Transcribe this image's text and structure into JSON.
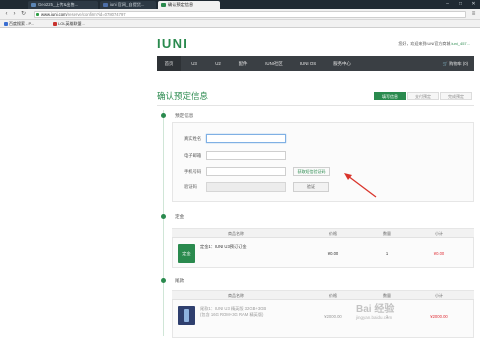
{
  "browser": {
    "tabs": [
      {
        "title": "Geo225_上传&出售...",
        "color": "#5c86b5",
        "active": false
      },
      {
        "title": "iuni 官网_自提货...",
        "color": "#4d6fa8",
        "active": false
      },
      {
        "title": "确认预定信息",
        "color": "#2a8a4e",
        "active": true
      }
    ],
    "window_controls": [
      "–",
      "□",
      "✕"
    ],
    "url_host": "www.iuni.com",
    "url_path": "/reserve/confirm?id=078074797",
    "bookmarks": [
      {
        "label": "百度搜索 - P...",
        "color": "#3a6ed1"
      },
      {
        "label": "LOL英雄联盟...",
        "color": "#c8332e"
      }
    ]
  },
  "site": {
    "logo": "IUNI",
    "top_links": {
      "greeting": "您好，欢迎来到IUNI官方商城",
      "user": "iuni_457..."
    },
    "nav": [
      "首页",
      "U3",
      "U2",
      "配件",
      "IUNI社区",
      "IUNI OS",
      "服务中心"
    ],
    "cart": "购物车 (0)"
  },
  "page": {
    "title": "确认预定信息",
    "steps": [
      "填写信息",
      "支付预定",
      "完成预定"
    ]
  },
  "form": {
    "section": "预定信息",
    "fields": {
      "name_label": "真实姓名",
      "email_label": "电子邮箱",
      "phone_label": "手机号码",
      "code_label": "验证码"
    },
    "sms_button": "获取短信验证码",
    "verify_button": "验证"
  },
  "deposit": {
    "section": "定金",
    "columns": [
      "商品名称",
      "价格",
      "数量",
      "小计"
    ],
    "rows": [
      {
        "thumb_label": "定金",
        "thumb_color": "#2a8a4e",
        "name": "定金1：IUNI U3预订订金",
        "price": "¥0.00",
        "qty": "1",
        "subtotal": "¥0.00"
      }
    ]
  },
  "balance": {
    "section": "尾款",
    "columns": [
      "商品名称",
      "价格",
      "数量",
      "小计"
    ],
    "rows": [
      {
        "thumb_color": "#2f3f6e",
        "name": "尾款1：IUNI U3 精英版 32GB+3GB",
        "sub": "(包含 16G ROM+3G RAM 精英版)",
        "price": "¥2000.00",
        "qty": "1",
        "subtotal": "¥2000.00"
      }
    ]
  },
  "watermark": {
    "text": "Bai 经验",
    "sub": "jingyan.baidu.com"
  }
}
